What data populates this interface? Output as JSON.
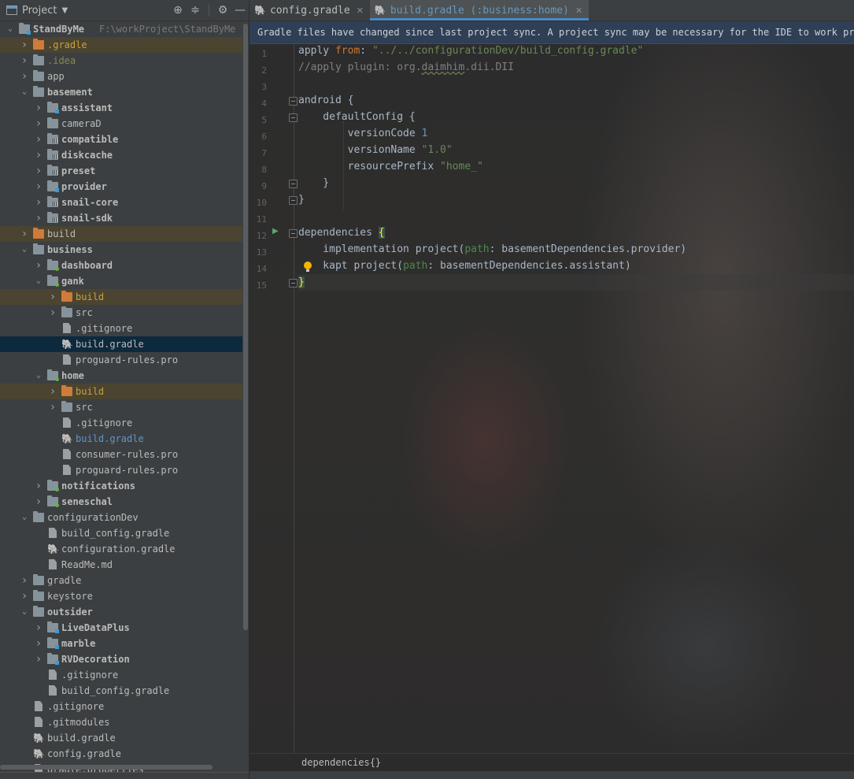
{
  "project_panel": {
    "title": "Project",
    "tree": [
      {
        "label": "StandByMe",
        "hint": "F:\\workProject\\StandByMe",
        "depth": 0,
        "expanded": true,
        "icon": "folder-module",
        "bold": true
      },
      {
        "label": ".gradle",
        "depth": 1,
        "expanded": false,
        "icon": "folder-orange",
        "color": "orange",
        "hl": "excluded"
      },
      {
        "label": ".idea",
        "depth": 1,
        "expanded": false,
        "icon": "folder-gray",
        "color": "olive"
      },
      {
        "label": "app",
        "depth": 1,
        "expanded": false,
        "icon": "folder-gray"
      },
      {
        "label": "basement",
        "depth": 1,
        "expanded": true,
        "icon": "folder-gray",
        "bold": true
      },
      {
        "label": "assistant",
        "depth": 2,
        "expanded": false,
        "icon": "folder-module",
        "bold": true
      },
      {
        "label": "cameraD",
        "depth": 2,
        "expanded": false,
        "icon": "folder-gray"
      },
      {
        "label": "compatible",
        "depth": 2,
        "expanded": false,
        "icon": "folder-bars",
        "bold": true
      },
      {
        "label": "diskcache",
        "depth": 2,
        "expanded": false,
        "icon": "folder-bars",
        "bold": true
      },
      {
        "label": "preset",
        "depth": 2,
        "expanded": false,
        "icon": "folder-bars",
        "bold": true
      },
      {
        "label": "provider",
        "depth": 2,
        "expanded": false,
        "icon": "folder-module",
        "bold": true
      },
      {
        "label": "snail-core",
        "depth": 2,
        "expanded": false,
        "icon": "folder-bars",
        "bold": true
      },
      {
        "label": "snail-sdk",
        "depth": 2,
        "expanded": false,
        "icon": "folder-bars",
        "bold": true
      },
      {
        "label": "build",
        "depth": 1,
        "expanded": false,
        "icon": "folder-orange",
        "hl": "excluded"
      },
      {
        "label": "business",
        "depth": 1,
        "expanded": true,
        "icon": "folder-gray",
        "bold": true
      },
      {
        "label": "dashboard",
        "depth": 2,
        "expanded": false,
        "icon": "folder-green",
        "bold": true
      },
      {
        "label": "gank",
        "depth": 2,
        "expanded": true,
        "icon": "folder-green",
        "bold": true
      },
      {
        "label": "build",
        "depth": 3,
        "expanded": false,
        "icon": "folder-orange",
        "color": "orange",
        "hl": "excluded"
      },
      {
        "label": "src",
        "depth": 3,
        "expanded": false,
        "icon": "folder-gray"
      },
      {
        "label": ".gitignore",
        "depth": 3,
        "icon": "file"
      },
      {
        "label": "build.gradle",
        "depth": 3,
        "icon": "gradle",
        "hl": "selected"
      },
      {
        "label": "proguard-rules.pro",
        "depth": 3,
        "icon": "file"
      },
      {
        "label": "home",
        "depth": 2,
        "expanded": true,
        "icon": "folder-green",
        "bold": true
      },
      {
        "label": "build",
        "depth": 3,
        "expanded": false,
        "icon": "folder-orange",
        "color": "orange",
        "hl": "excluded"
      },
      {
        "label": "src",
        "depth": 3,
        "expanded": false,
        "icon": "folder-gray"
      },
      {
        "label": ".gitignore",
        "depth": 3,
        "icon": "file"
      },
      {
        "label": "build.gradle",
        "depth": 3,
        "icon": "gradle",
        "color": "blue"
      },
      {
        "label": "consumer-rules.pro",
        "depth": 3,
        "icon": "file"
      },
      {
        "label": "proguard-rules.pro",
        "depth": 3,
        "icon": "file"
      },
      {
        "label": "notifications",
        "depth": 2,
        "expanded": false,
        "icon": "folder-green",
        "bold": true
      },
      {
        "label": "seneschal",
        "depth": 2,
        "expanded": false,
        "icon": "folder-green",
        "bold": true
      },
      {
        "label": "configurationDev",
        "depth": 1,
        "expanded": true,
        "icon": "folder-gray"
      },
      {
        "label": "build_config.gradle",
        "depth": 2,
        "icon": "file"
      },
      {
        "label": "configuration.gradle",
        "depth": 2,
        "icon": "gradle"
      },
      {
        "label": "ReadMe.md",
        "depth": 2,
        "icon": "file"
      },
      {
        "label": "gradle",
        "depth": 1,
        "expanded": false,
        "icon": "folder-gray"
      },
      {
        "label": "keystore",
        "depth": 1,
        "expanded": false,
        "icon": "folder-gray"
      },
      {
        "label": "outsider",
        "depth": 1,
        "expanded": true,
        "icon": "folder-gray",
        "bold": true
      },
      {
        "label": "LiveDataPlus",
        "depth": 2,
        "expanded": false,
        "icon": "folder-module",
        "bold": true
      },
      {
        "label": "marble",
        "depth": 2,
        "expanded": false,
        "icon": "folder-module",
        "bold": true
      },
      {
        "label": "RVDecoration",
        "depth": 2,
        "expanded": false,
        "icon": "folder-module",
        "bold": true
      },
      {
        "label": ".gitignore",
        "depth": 2,
        "icon": "file"
      },
      {
        "label": "build_config.gradle",
        "depth": 2,
        "icon": "file"
      },
      {
        "label": ".gitignore",
        "depth": 1,
        "icon": "file"
      },
      {
        "label": ".gitmodules",
        "depth": 1,
        "icon": "file"
      },
      {
        "label": "build.gradle",
        "depth": 1,
        "icon": "gradle"
      },
      {
        "label": "config.gradle",
        "depth": 1,
        "icon": "gradle"
      },
      {
        "label": "gradle.properties",
        "depth": 1,
        "icon": "file"
      }
    ]
  },
  "editor": {
    "tabs": [
      {
        "label": "config.gradle",
        "active": false
      },
      {
        "label": "build.gradle (:business:home)",
        "active": true
      }
    ],
    "banner": "Gradle files have changed since last project sync. A project sync may be necessary for the IDE to work prope",
    "line_numbers": [
      "1",
      "2",
      "3",
      "4",
      "5",
      "6",
      "7",
      "8",
      "9",
      "10",
      "11",
      "12",
      "13",
      "14",
      "15"
    ],
    "breadcrumb": "dependencies{}"
  }
}
